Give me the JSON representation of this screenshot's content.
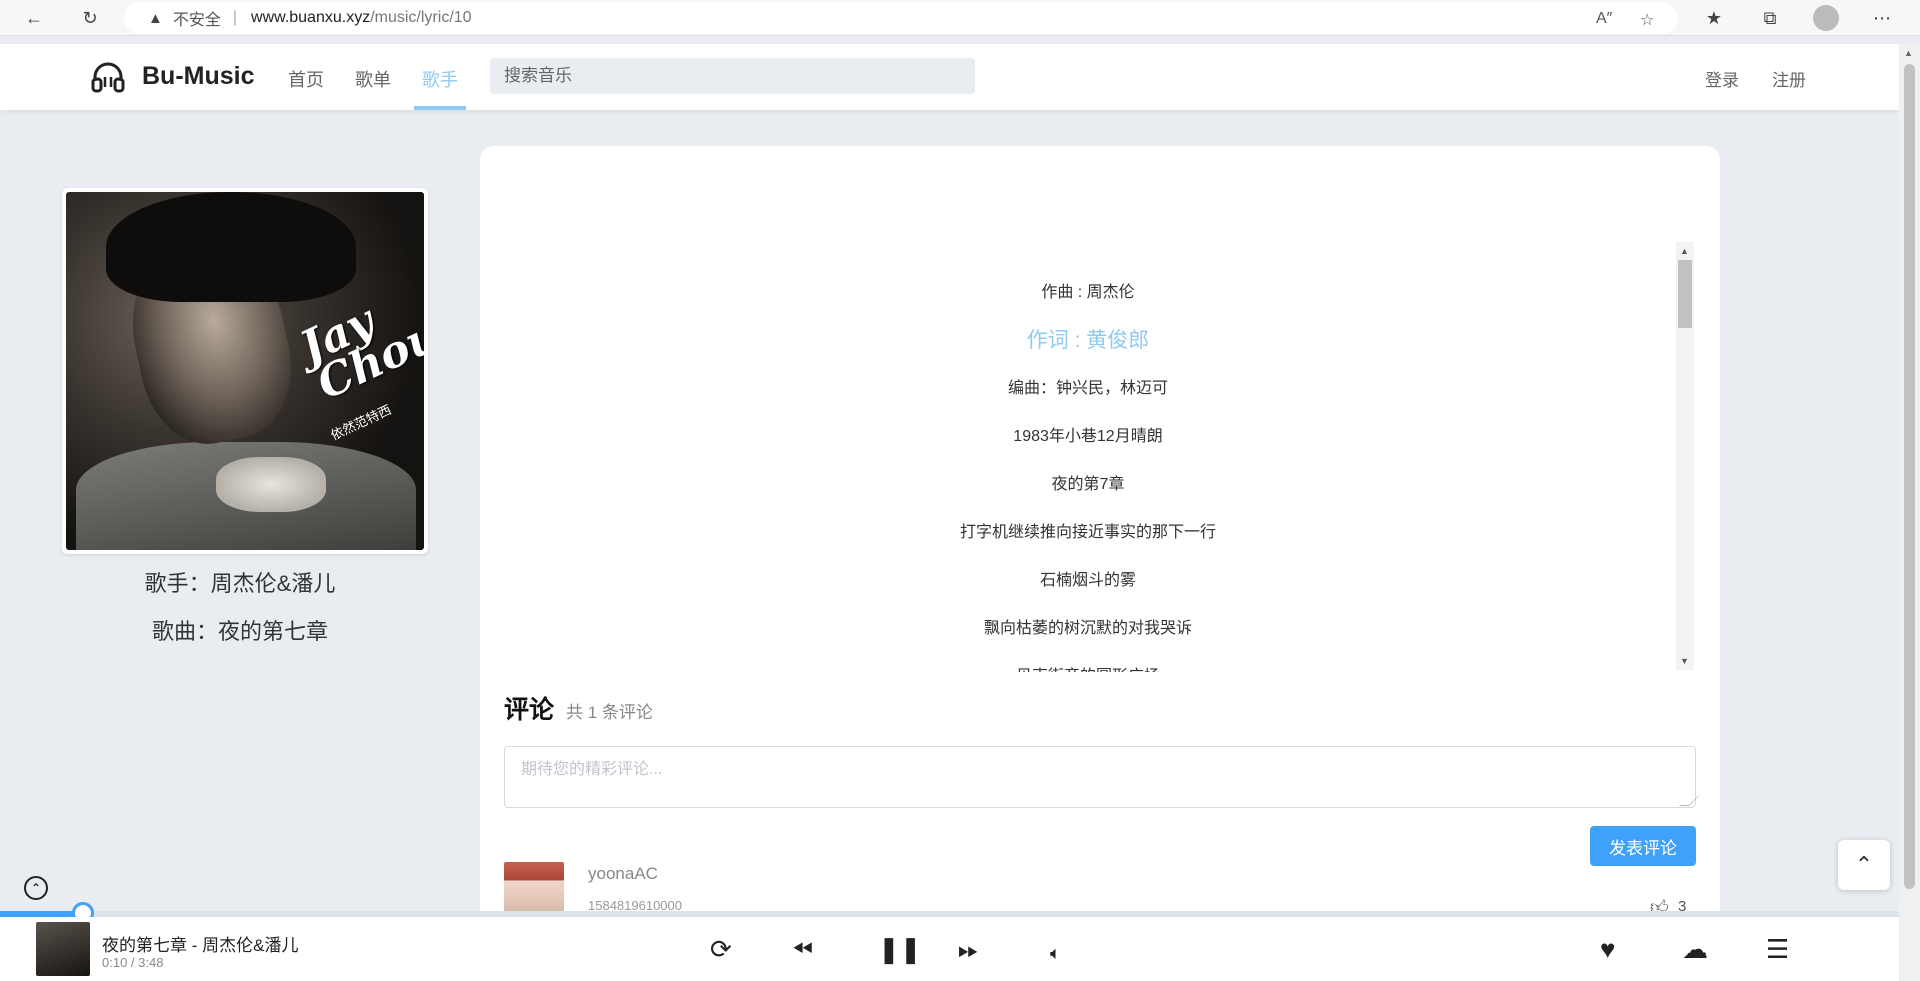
{
  "browser": {
    "insecure_label": "不安全",
    "url_host": "www.buanxu.xyz",
    "url_path": "/music/lyric/10"
  },
  "header": {
    "logo": "Bu-Music",
    "nav": [
      "首页",
      "歌单",
      "歌手"
    ],
    "active_nav": "歌手",
    "search_placeholder": "搜索音乐",
    "login": "登录",
    "register": "注册"
  },
  "artist": {
    "album_title": "Jay Chou",
    "album_subtitle": "依然范特西",
    "singer_line": "歌手：周杰伦&潘儿",
    "song_line": "歌曲：夜的第七章"
  },
  "lyrics": {
    "lines": [
      "作曲 : 周杰伦",
      "作词 : 黄俊郎",
      "编曲：钟兴民，林迈可",
      "1983年小巷12月晴朗",
      "夜的第7章",
      "打字机继续推向接近事实的那下一行",
      "石楠烟斗的雾",
      "飘向枯萎的树沉默的对我哭诉",
      "贝克街旁的圆形广场"
    ],
    "active_index": 1
  },
  "comments": {
    "title": "评论",
    "count_label": "共 1 条评论",
    "input_placeholder": "期待您的精彩评论...",
    "submit_label": "发表评论",
    "items": [
      {
        "user": "yoonaAC",
        "time": "1584819610000",
        "likes": "3"
      }
    ]
  },
  "player": {
    "now_playing": "夜的第七章 - 周杰伦&潘儿",
    "time": "0:10 / 3:48",
    "progress_fraction": 0.0437
  },
  "colors": {
    "accent": "#8ecbf0",
    "button": "#3fa1f7",
    "page_bg": "#e9edf2"
  }
}
